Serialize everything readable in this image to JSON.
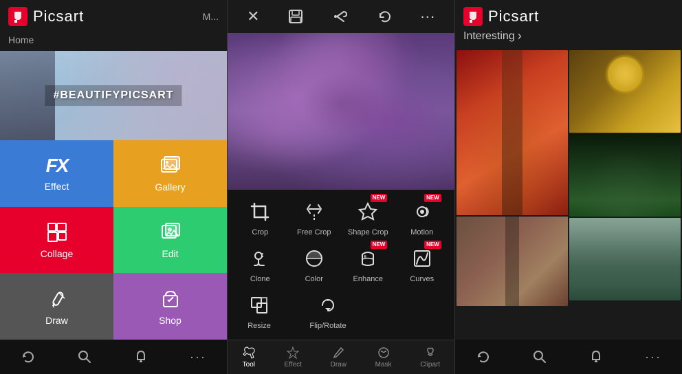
{
  "panel1": {
    "app_title": "Picsart",
    "home_label": "Home",
    "more_label": "M...",
    "banner_text": "#BEAUTIFYPICSART",
    "tiles": [
      {
        "id": "effect",
        "label": "Effect",
        "color": "#3a7bd5",
        "icon": "FX"
      },
      {
        "id": "gallery",
        "label": "Gallery",
        "color": "#e8a020",
        "icon": "🖼"
      },
      {
        "id": "collage",
        "label": "Collage",
        "color": "#e8002d",
        "icon": "⊞"
      },
      {
        "id": "edit",
        "label": "Edit",
        "color": "#2ecc71",
        "icon": "🖼"
      },
      {
        "id": "draw",
        "label": "Draw",
        "color": "#555555",
        "icon": "✏"
      },
      {
        "id": "shop",
        "label": "Shop",
        "color": "#9b59b6",
        "icon": "🛍"
      }
    ],
    "bottom_bar": {
      "refresh": "↺",
      "search": "🔍",
      "bell": "🔔",
      "more": "···"
    }
  },
  "panel2": {
    "toolbar": {
      "close": "✕",
      "save": "💾",
      "share": "↗",
      "undo": "↺",
      "more": "···"
    },
    "tools_row1": [
      {
        "id": "crop",
        "label": "Crop",
        "icon": "crop",
        "new": false
      },
      {
        "id": "free-crop",
        "label": "Free Crop",
        "icon": "scissors",
        "new": false
      },
      {
        "id": "shape-crop",
        "label": "Shape Crop",
        "icon": "star",
        "new": true
      },
      {
        "id": "motion",
        "label": "Motion",
        "icon": "motion",
        "new": true
      }
    ],
    "tools_row2": [
      {
        "id": "clone",
        "label": "Clone",
        "icon": "clone",
        "new": false
      },
      {
        "id": "color",
        "label": "Color",
        "icon": "color",
        "new": false
      },
      {
        "id": "enhance",
        "label": "Enhance",
        "icon": "enhance",
        "new": true
      },
      {
        "id": "curves",
        "label": "Curves",
        "icon": "curves",
        "new": true
      }
    ],
    "tools_row3": [
      {
        "id": "resize",
        "label": "Resize",
        "icon": "resize",
        "new": false
      },
      {
        "id": "flip-rotate",
        "label": "Flip/Rotate",
        "icon": "rotate",
        "new": false
      }
    ],
    "bottom_tabs": [
      {
        "id": "tool",
        "label": "Tool",
        "active": true
      },
      {
        "id": "effect",
        "label": "Effect",
        "active": false
      },
      {
        "id": "draw",
        "label": "Draw",
        "active": false
      },
      {
        "id": "mask",
        "label": "Mask",
        "active": false
      },
      {
        "id": "clipart",
        "label": "Clipart",
        "active": false
      }
    ]
  },
  "panel3": {
    "app_title": "Picsart",
    "section_label": "Interesting",
    "section_arrow": "›",
    "bottom_bar": {
      "refresh": "↺",
      "search": "🔍",
      "bell": "🔔",
      "more": "···"
    }
  }
}
